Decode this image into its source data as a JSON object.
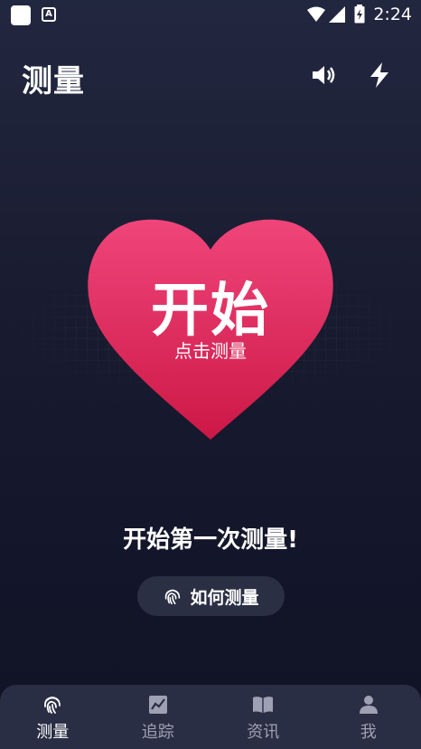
{
  "status_bar": {
    "time": "2:24",
    "app_icon_letter": "A"
  },
  "header": {
    "title": "测量",
    "sound_icon": "speaker-icon",
    "flash_icon": "lightning-icon"
  },
  "heart_button": {
    "main": "开始",
    "sub": "点击测量",
    "color_top": "#f0457a",
    "color_bottom": "#d01a48"
  },
  "prompt": {
    "text": "开始第一次测量!"
  },
  "how_button": {
    "label": "如何测量",
    "icon": "fingerprint-icon"
  },
  "nav": {
    "items": [
      {
        "label": "测量",
        "icon": "fingerprint-icon",
        "active": true
      },
      {
        "label": "追踪",
        "icon": "chart-icon",
        "active": false
      },
      {
        "label": "资讯",
        "icon": "book-icon",
        "active": false
      },
      {
        "label": "我",
        "icon": "person-icon",
        "active": false
      }
    ]
  }
}
